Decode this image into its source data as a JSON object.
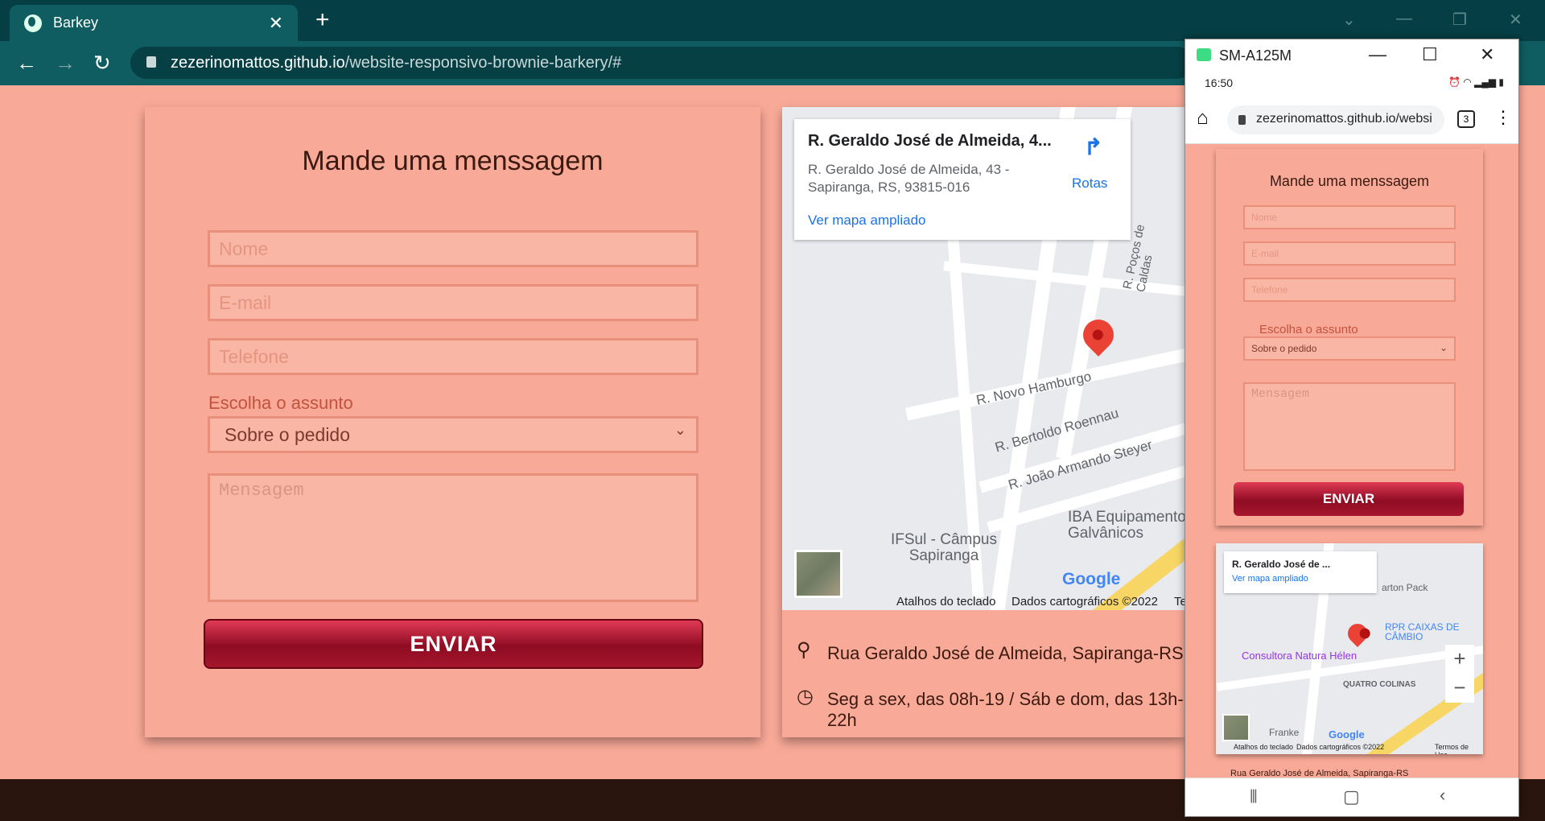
{
  "browser": {
    "tab_title": "Barkey",
    "url_host": "zezerinomattos.github.io",
    "url_path": "/website-responsivo-brownie-barkery/#"
  },
  "form": {
    "title": "Mande uma menssagem",
    "name_placeholder": "Nome",
    "email_placeholder": "E-mail",
    "phone_placeholder": "Telefone",
    "subject_label": "Escolha o assunto",
    "subject_selected": "Sobre o pedido",
    "message_placeholder": "Mensagem",
    "submit_label": "ENVIAR"
  },
  "map": {
    "place_title": "R. Geraldo José de Almeida, 4...",
    "place_address": "R. Geraldo José de Almeida, 43 - Sapiranga, RS, 93815-016",
    "directions_label": "Rotas",
    "larger_map_label": "Ver mapa ampliado",
    "streets": [
      "R. Novo Hamburgo",
      "R. Bertoldo Roennau",
      "R. João Armando Steyer",
      "R. Poços de Caldas"
    ],
    "poi_1": "IFSul - Câmpus Sapiranga",
    "poi_2": "IBA Equipamentos Galvânicos",
    "google_logo": "Google",
    "shortcuts": "Atalhos do teclado",
    "map_data": "Dados cartográficos ©2022",
    "terms": "Te"
  },
  "contact": {
    "address": "Rua Geraldo José de Almeida, Sapiranga-RS",
    "hours": "Seg a sex, das 08h-19 / Sáb e dom, das 13h-22h"
  },
  "phone": {
    "window_title": "SM-A125M",
    "time": "16:50",
    "url": "zezerinomattos.github.io/websi",
    "tab_count": "3",
    "form_title": "Mande uma menssagem",
    "name_placeholder": "Nome",
    "email_placeholder": "E-mail",
    "phone_placeholder": "Telefone",
    "subject_label": "Escolha o assunto",
    "subject_selected": "Sobre o pedido",
    "message_placeholder": "Mensagem",
    "submit_label": "ENVIAR",
    "map_title": "R. Geraldo José de ...",
    "map_link": "Ver mapa ampliado",
    "poi_1": "RPR CAIXAS DE CÂMBIO",
    "poi_2": "Consultora Natura Hélen",
    "poi_3": "QUATRO COLINAS",
    "poi_4": "arton Pack",
    "poi_5": "Franke",
    "google_logo": "Google",
    "shortcuts": "Atalhos do teclado",
    "map_data": "Dados cartográficos ©2022",
    "terms": "Termos de Uso",
    "footer_address": "Rua Geraldo José de Almeida, Sapiranga-RS"
  },
  "colors": {
    "page_bg": "#f9a997",
    "button": "#8e0c22",
    "footer": "#2a150e",
    "chrome": "#0f5c61"
  }
}
